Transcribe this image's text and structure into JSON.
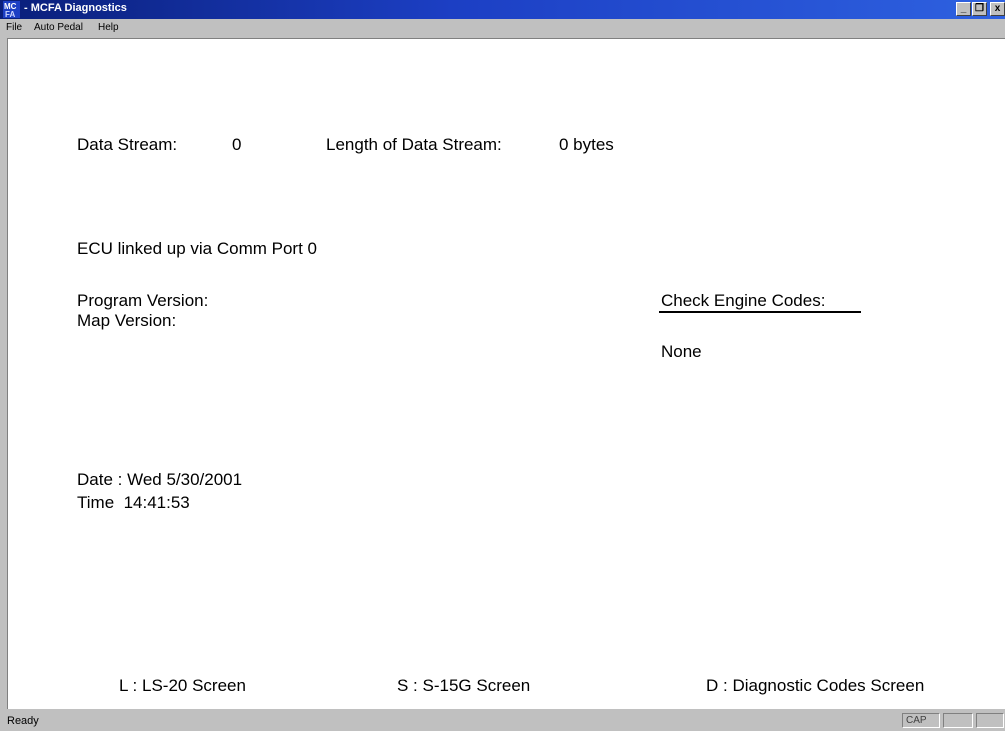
{
  "window": {
    "title": "- MCFA Diagnostics",
    "icon": "app-icon",
    "controls": {
      "minimize": "_",
      "restore": "❐",
      "close": "x"
    }
  },
  "menu": [
    "File",
    "Auto Pedal",
    "Help"
  ],
  "main": {
    "data_stream_label": "Data Stream:",
    "data_stream_value": "0",
    "length_label": "Length of Data Stream:",
    "length_value": "0 bytes",
    "ecu_status": "ECU linked up via Comm Port 0",
    "program_version_label": "Program Version:",
    "map_version_label": "Map Version:",
    "check_engine_label": "Check Engine Codes:",
    "check_engine_value": "None",
    "date_line": "Date : Wed 5/30/2001",
    "time_line": "Time  14:41:53"
  },
  "shortcuts": [
    "L : LS-20 Screen",
    "S : S-15G Screen",
    "D : Diagnostic Codes Screen"
  ],
  "status": {
    "text": "Ready",
    "cap": "CAP"
  }
}
